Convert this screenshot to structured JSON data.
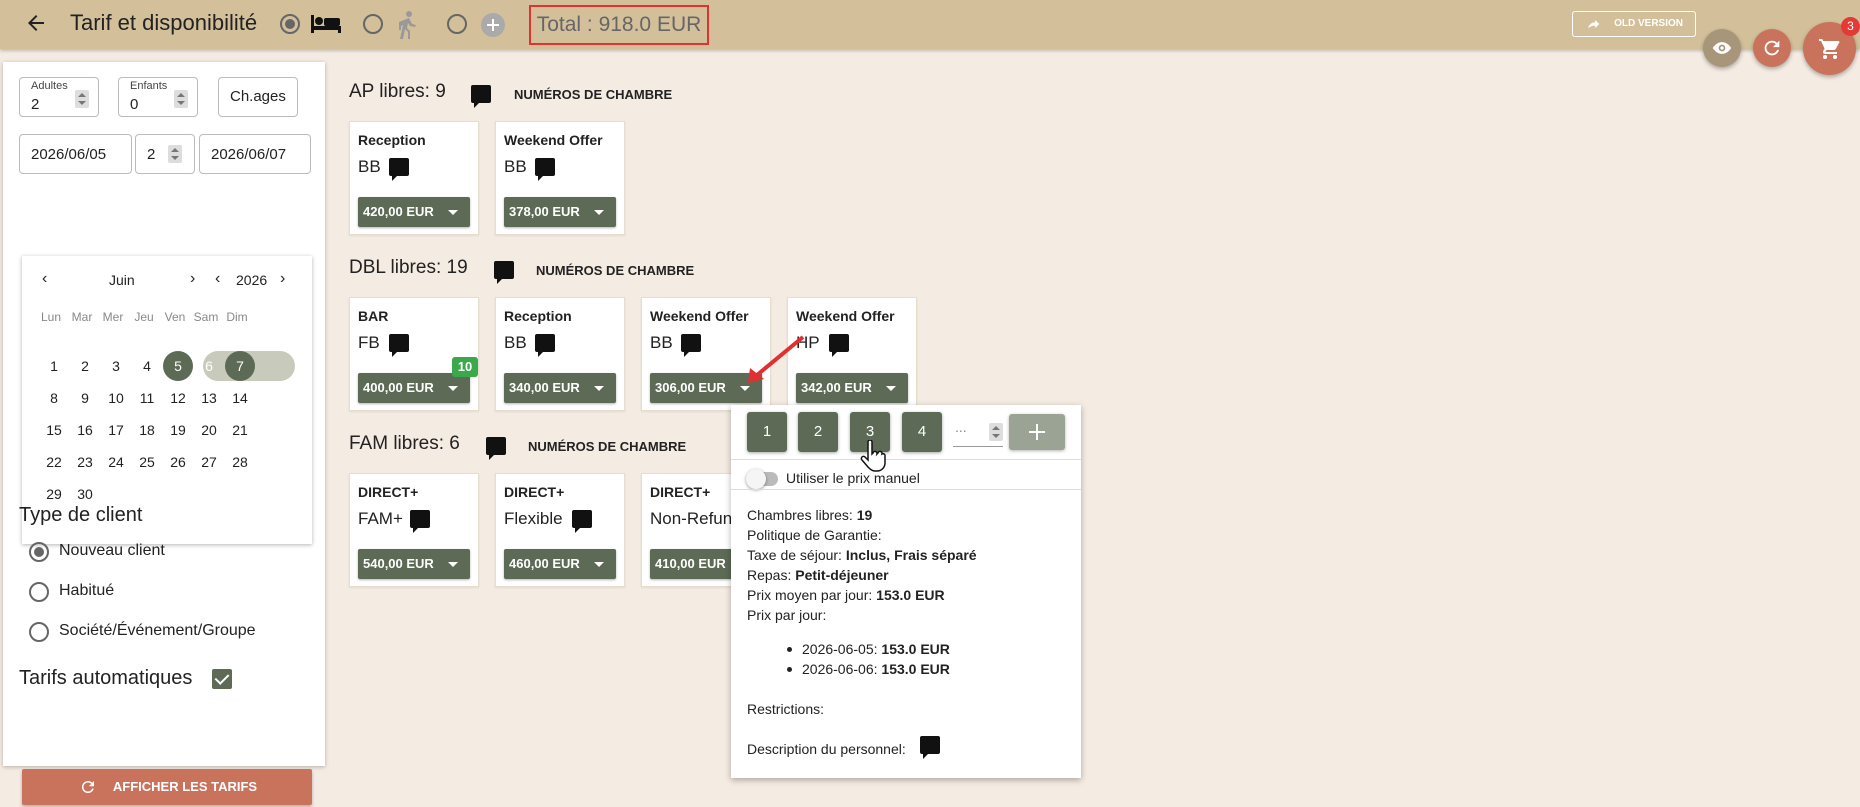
{
  "header": {
    "title": "Tarif et disponibilité",
    "total": "Total : 918.0 EUR",
    "old_version": "OLD VERSION",
    "cart_count": "3",
    "modes": [
      {
        "icon": "bed-icon",
        "selected": true
      },
      {
        "icon": "walking-icon",
        "selected": false
      },
      {
        "icon": "add-circle-icon",
        "selected": false
      }
    ]
  },
  "search": {
    "adults_label": "Adultes",
    "adults_value": "2",
    "children_label": "Enfants",
    "children_value": "0",
    "ages_placeholder": "Ch.ages",
    "checkin": "2026/06/05",
    "nights": "2",
    "checkout": "2026/06/07"
  },
  "calendar": {
    "month": "Juin",
    "year": "2026",
    "weekdays": [
      "Lun",
      "Mar",
      "Mer",
      "Jeu",
      "Ven",
      "Sam",
      "Dim"
    ],
    "days": [
      "1",
      "2",
      "3",
      "4",
      "5",
      "6",
      "7",
      "8",
      "9",
      "10",
      "11",
      "12",
      "13",
      "14",
      "15",
      "16",
      "17",
      "18",
      "19",
      "20",
      "21",
      "22",
      "23",
      "24",
      "25",
      "26",
      "27",
      "28",
      "29",
      "30"
    ],
    "selected_start": "5",
    "selected_end": "7"
  },
  "client": {
    "title": "Type de client",
    "options": [
      "Nouveau client",
      "Habitué",
      "Société/Événement/Groupe"
    ],
    "selected": "Nouveau client",
    "auto_rates_label": "Tarifs automatiques",
    "auto_rates_checked": true,
    "show_rates_button": "AFFICHER LES TARIFS"
  },
  "rooms": [
    {
      "header": "AP libres: 9",
      "numbers_label": "NUMÉROS DE CHAMBRE",
      "rates": [
        {
          "name": "Reception",
          "board": "BB",
          "price": "420,00 EUR"
        },
        {
          "name": "Weekend Offer",
          "board": "BB",
          "price": "378,00 EUR"
        }
      ]
    },
    {
      "header": "DBL libres: 19",
      "numbers_label": "NUMÉROS DE CHAMBRE",
      "rates": [
        {
          "name": "BAR",
          "board": "FB",
          "price": "400,00 EUR",
          "badge": "10"
        },
        {
          "name": "Reception",
          "board": "BB",
          "price": "340,00 EUR"
        },
        {
          "name": "Weekend Offer",
          "board": "BB",
          "price": "306,00 EUR"
        },
        {
          "name": "Weekend Offer",
          "board": "HP",
          "price": "342,00 EUR"
        }
      ]
    },
    {
      "header": "FAM libres: 6",
      "numbers_label": "NUMÉROS DE CHAMBRE",
      "rates": [
        {
          "name": "DIRECT+",
          "board": "FAM+",
          "price": "540,00 EUR"
        },
        {
          "name": "DIRECT+",
          "board": "Flexible",
          "price": "460,00 EUR"
        },
        {
          "name": "DIRECT+",
          "board": "Non-Refun",
          "price": "410,00 EUR"
        }
      ]
    }
  ],
  "popup": {
    "qty_buttons": [
      "1",
      "2",
      "3",
      "4"
    ],
    "qty_placeholder": "...",
    "manual_price_label": "Utiliser le prix manuel",
    "free_rooms_label": "Chambres libres:",
    "free_rooms_value": "19",
    "guarantee_label": "Politique de Garantie:",
    "tax_label": "Taxe de séjour:",
    "tax_value": "Inclus, Frais séparé",
    "meal_label": "Repas:",
    "meal_value": "Petit-déjeuner",
    "avg_price_label": "Prix moyen par jour:",
    "avg_price_value": "153.0 EUR",
    "price_per_day_label": "Prix par jour:",
    "daily_prices": [
      {
        "date": "2026-06-05:",
        "price": "153.0 EUR"
      },
      {
        "date": "2026-06-06:",
        "price": "153.0 EUR"
      }
    ],
    "restrictions_label": "Restrictions:",
    "staff_desc_label": "Description du personnel:"
  },
  "colors": {
    "topbar": "#d3c09a",
    "accent_green": "#5d6a55",
    "action_orange": "#c9735c",
    "total_border": "#dd3333",
    "badge_green": "#3aa84b",
    "cart_red": "#e53935"
  }
}
